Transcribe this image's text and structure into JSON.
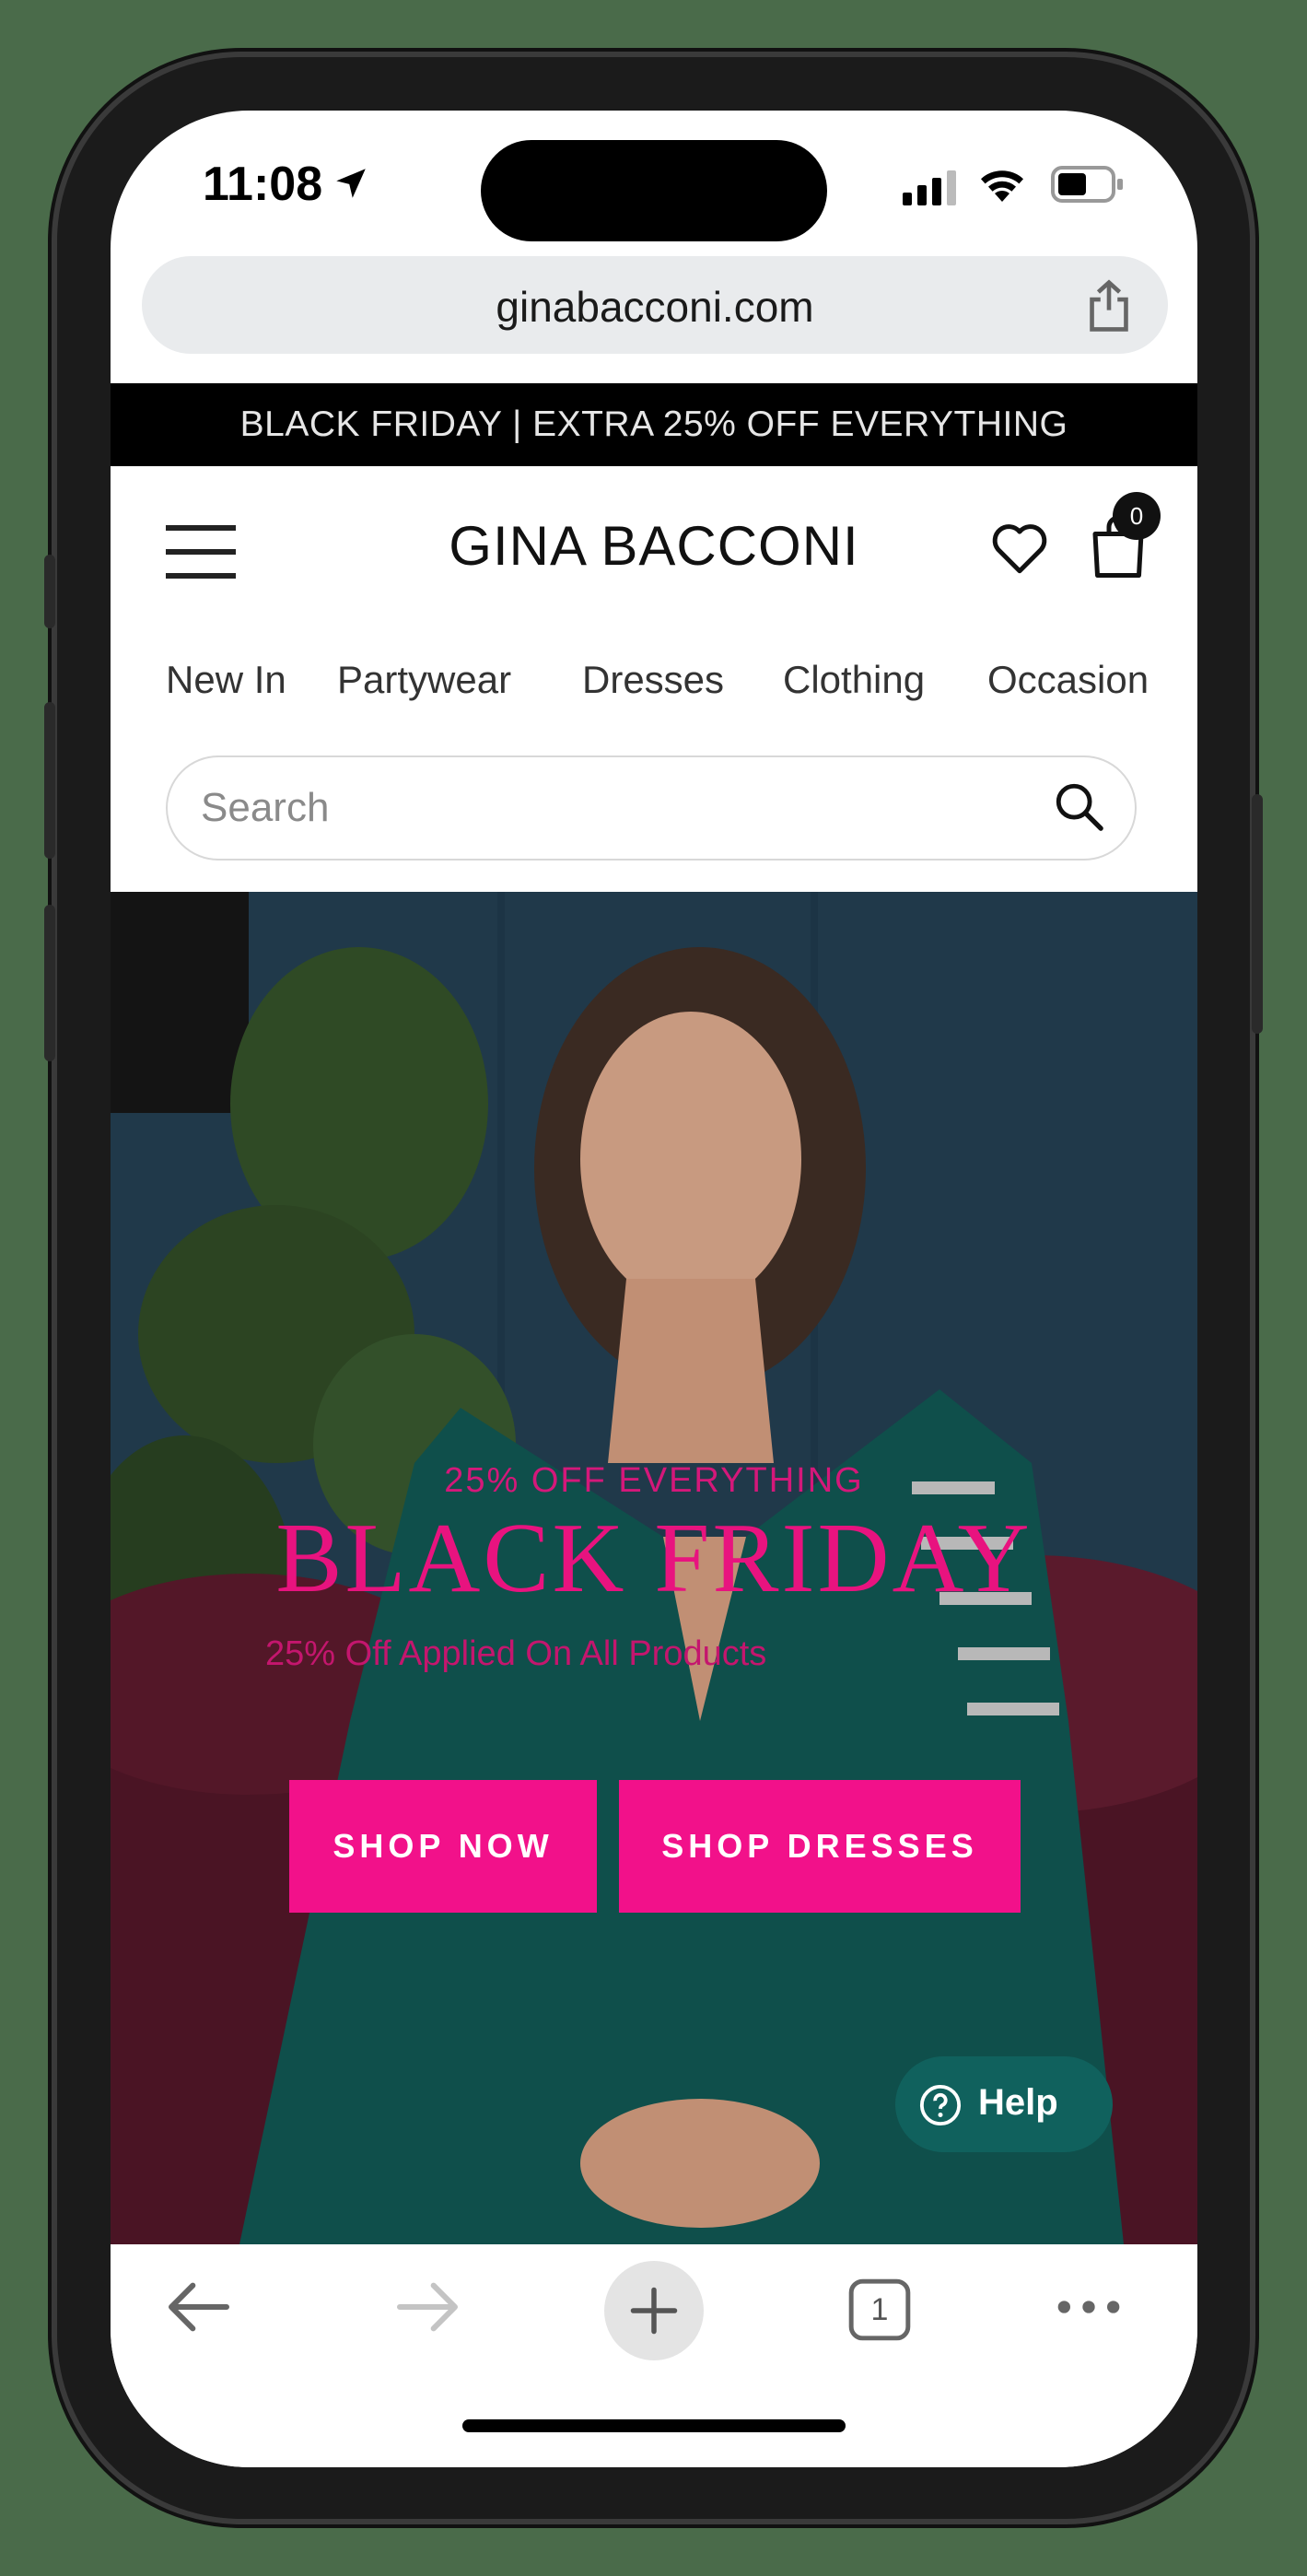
{
  "status_bar": {
    "time": "11:08"
  },
  "browser": {
    "url": "ginabacconi.com",
    "tab_count": "1"
  },
  "promo_banner": "BLACK FRIDAY | EXTRA 25% OFF EVERYTHING",
  "header": {
    "brand": "GINA BACCONI",
    "cart_count": "0"
  },
  "categories": [
    "New In",
    "Partywear",
    "Dresses",
    "Clothing",
    "Occasion"
  ],
  "search": {
    "placeholder": "Search"
  },
  "hero": {
    "subtitle": "25% OFF EVERYTHING",
    "title": "BLACK FRIDAY",
    "note": "25% Off Applied On All Products",
    "button_shop_now": "SHOP NOW",
    "button_shop_dresses": "SHOP DRESSES"
  },
  "help_widget": {
    "label": "Help"
  },
  "colors": {
    "accent_pink": "#f2118a",
    "help_teal": "#10615d",
    "promo_bg": "#000000"
  }
}
